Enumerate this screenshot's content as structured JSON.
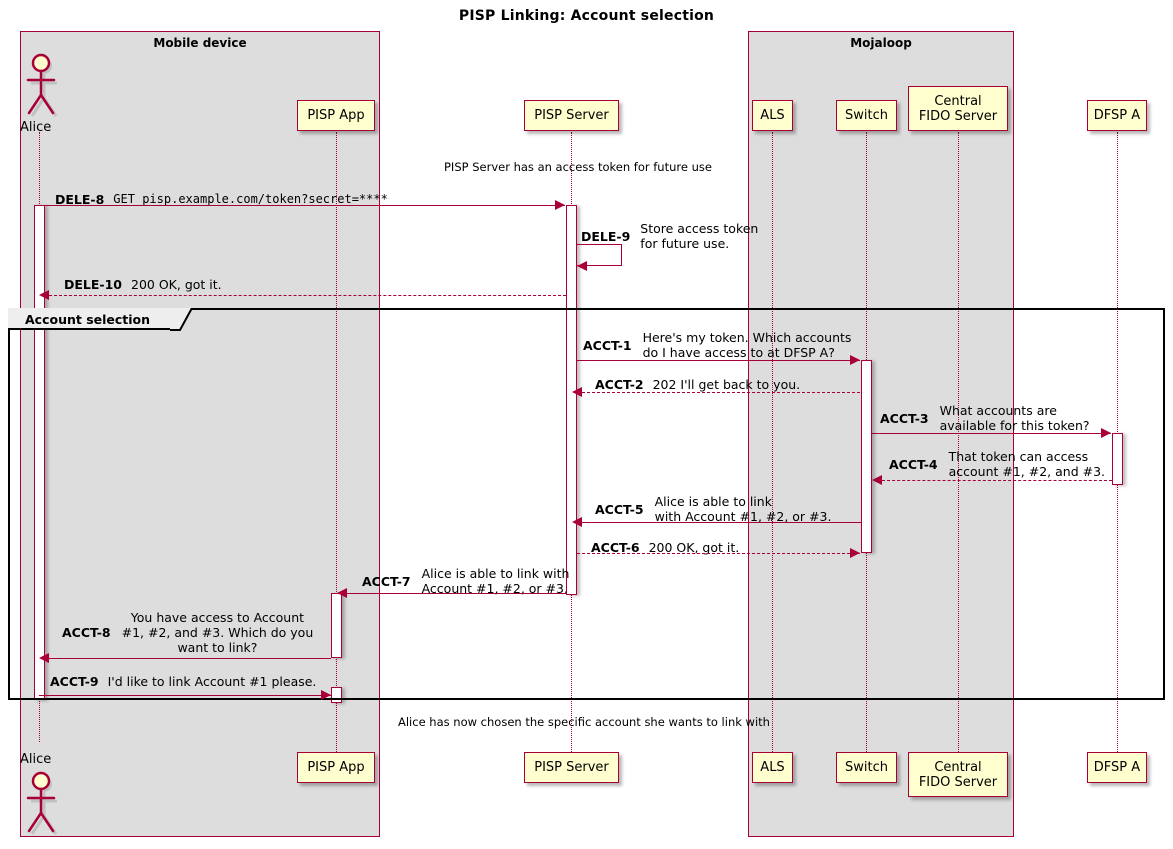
{
  "title": "PISP Linking: Account selection",
  "groups": [
    {
      "id": "mobile-device",
      "label": "Mobile device"
    },
    {
      "id": "mojaloop",
      "label": "Mojaloop"
    }
  ],
  "participants": [
    {
      "id": "alice",
      "label": "Alice",
      "type": "actor"
    },
    {
      "id": "pisp-app",
      "label": "PISP App",
      "type": "participant"
    },
    {
      "id": "pisp-server",
      "label": "PISP Server",
      "type": "participant"
    },
    {
      "id": "als",
      "label": "ALS",
      "type": "participant"
    },
    {
      "id": "switch",
      "label": "Switch",
      "type": "participant"
    },
    {
      "id": "central-fido-server",
      "label": "Central\nFIDO Server",
      "type": "participant"
    },
    {
      "id": "dfsp-a",
      "label": "DFSP A",
      "type": "participant"
    }
  ],
  "notes": [
    {
      "id": "note-top",
      "text": "PISP Server has an access token for future use"
    },
    {
      "id": "note-bottom",
      "text": "Alice has now chosen the specific account she wants to link with"
    }
  ],
  "fragment": {
    "label": "Account selection"
  },
  "messages": [
    {
      "id": "dele-8",
      "seq": "DELE-8",
      "body": "GET pisp.example.com/token?secret=****",
      "mono": true,
      "from": "alice",
      "to": "pisp-server"
    },
    {
      "id": "dele-9",
      "seq": "DELE-9",
      "body_lines": [
        "Store access token",
        "for future use."
      ],
      "from": "pisp-server",
      "to": "pisp-server"
    },
    {
      "id": "dele-10",
      "seq": "DELE-10",
      "body": "200 OK, got it.",
      "from": "pisp-server",
      "to": "alice"
    },
    {
      "id": "acct-1",
      "seq": "ACCT-1",
      "body_lines": [
        "Here's my token. Which accounts",
        "do I have access to at DFSP A?"
      ],
      "from": "pisp-server",
      "to": "switch"
    },
    {
      "id": "acct-2",
      "seq": "ACCT-2",
      "body": "202 I'll get back to you.",
      "from": "switch",
      "to": "pisp-server"
    },
    {
      "id": "acct-3",
      "seq": "ACCT-3",
      "body_lines": [
        "What accounts are",
        "available for this token?"
      ],
      "from": "switch",
      "to": "dfsp-a"
    },
    {
      "id": "acct-4",
      "seq": "ACCT-4",
      "body_lines": [
        "That token can access",
        "account #1, #2, and #3."
      ],
      "from": "dfsp-a",
      "to": "switch"
    },
    {
      "id": "acct-5",
      "seq": "ACCT-5",
      "body_lines": [
        "Alice is able to link",
        "with Account #1, #2, or #3."
      ],
      "from": "switch",
      "to": "pisp-server"
    },
    {
      "id": "acct-6",
      "seq": "ACCT-6",
      "body": "200 OK, got it.",
      "from": "pisp-server",
      "to": "switch"
    },
    {
      "id": "acct-7",
      "seq": "ACCT-7",
      "body_lines": [
        "Alice is able to link with",
        "Account #1, #2, or #3."
      ],
      "from": "pisp-server",
      "to": "pisp-app"
    },
    {
      "id": "acct-8",
      "seq": "ACCT-8",
      "body_lines": [
        "You have access to Account",
        "#1, #2, and #3. Which do you",
        "want to link?"
      ],
      "from": "pisp-app",
      "to": "alice"
    },
    {
      "id": "acct-9",
      "seq": "ACCT-9",
      "body": "I'd like to link Account #1 please.",
      "from": "alice",
      "to": "pisp-app"
    }
  ],
  "colors": {
    "accent": "#A80036",
    "participant_fill": "#FEFECE",
    "group_fill": "#DDDDDD",
    "fragment_border": "#000000"
  }
}
